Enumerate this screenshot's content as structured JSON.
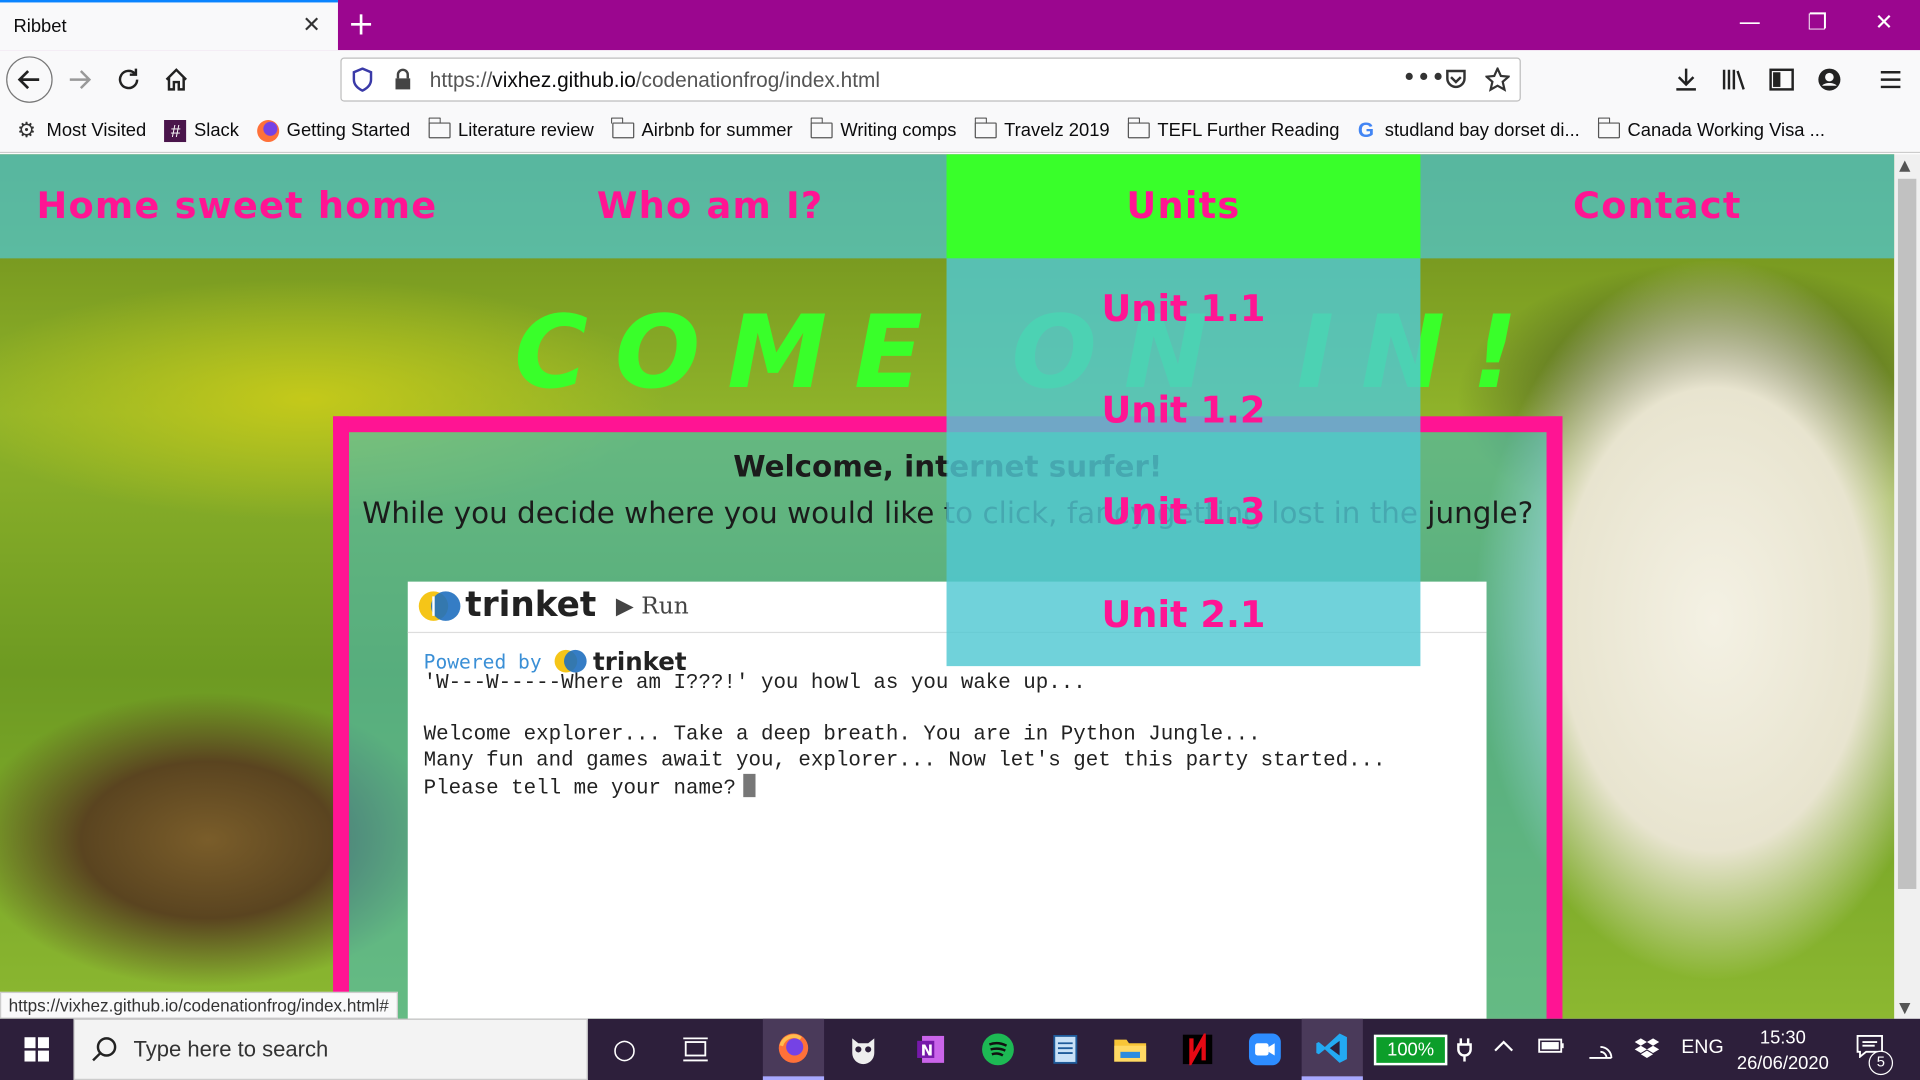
{
  "browser": {
    "tab_title": "Ribbet",
    "tab_close": "✕",
    "new_tab": "+",
    "window_controls": {
      "minimize": "—",
      "restore": "❐",
      "close": "✕"
    },
    "url_host": "vixhez.github.io",
    "url_prefix": "https://",
    "url_path": "/codenationfrog/index.html",
    "status_url": "https://vixhez.github.io/codenationfrog/index.html#",
    "bookmarks": [
      {
        "label": "Most Visited",
        "icon": "gear-icon"
      },
      {
        "label": "Slack",
        "icon": "slack-icon"
      },
      {
        "label": "Getting Started",
        "icon": "firefox-icon"
      },
      {
        "label": "Literature review",
        "icon": "folder-icon"
      },
      {
        "label": "Airbnb for summer",
        "icon": "folder-icon"
      },
      {
        "label": "Writing comps",
        "icon": "folder-icon"
      },
      {
        "label": "Travelz 2019",
        "icon": "folder-icon"
      },
      {
        "label": "TEFL Further Reading",
        "icon": "folder-icon"
      },
      {
        "label": "studland bay dorset di...",
        "icon": "google-icon"
      },
      {
        "label": "Canada Working Visa ...",
        "icon": "folder-icon"
      }
    ]
  },
  "site": {
    "nav": {
      "home": "Home sweet home",
      "who": "Who am I?",
      "units": "Units",
      "contact": "Contact"
    },
    "units_menu": [
      "Unit 1.1",
      "Unit 1.2",
      "Unit 1.3",
      "Unit 2.1"
    ],
    "hero": "COME ON IN!",
    "welcome": "Welcome, internet surfer!",
    "subline": "While you decide where you would like to click, fancy getting lost in the jungle?",
    "colors": {
      "accent_pink": "#ff1493",
      "neon_green": "#39ff2a",
      "teal_overlay": "#50c8d2"
    }
  },
  "trinket": {
    "brand": "trinket",
    "run_label": "Run",
    "powered_by": "Powered by",
    "console_lines": [
      "'W---W-----Where am I???!' you howl as you wake up...",
      "",
      "Welcome explorer... Take a deep breath. You are in Python Jungle...",
      "Many fun and games await you, explorer... Now let's get this party started...",
      "Please tell me your name?"
    ]
  },
  "taskbar": {
    "search_placeholder": "Type here to search",
    "battery": "100%",
    "language": "ENG",
    "time": "15:30",
    "date": "26/06/2020",
    "notifications": "5"
  }
}
